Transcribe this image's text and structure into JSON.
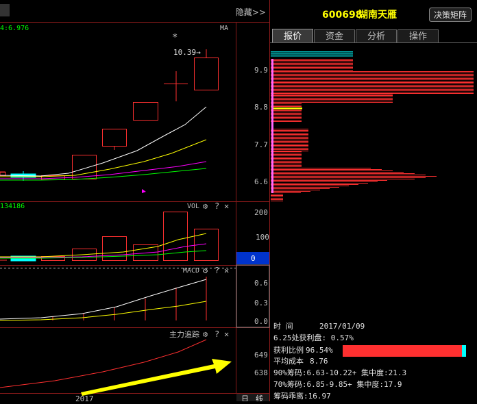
{
  "colors": {
    "bg": "#000000",
    "up": "#ff3030",
    "down": "#00ffff",
    "ma_white": "#ffffff",
    "ma_yellow": "#ffff00",
    "ma_magenta": "#ff00ff",
    "ma_green": "#00ff00",
    "label": "#c0c0c0",
    "stock": "#ffff00",
    "selected_value_bg": "#0033cc",
    "profit_bar": "#ff3030",
    "profit_bar_tail": "#00ffff"
  },
  "header": {
    "hide_label": "隐藏>>",
    "stock_code": "600698",
    "stock_name": "湖南天雁",
    "matrix_button": "决策矩阵"
  },
  "tabs": [
    {
      "label": "报价",
      "active": true
    },
    {
      "label": "资金",
      "active": false
    },
    {
      "label": "分析",
      "active": false
    },
    {
      "label": "操作",
      "active": false
    }
  ],
  "main_chart": {
    "ma_readout": "4:6.976",
    "ma_label": "MA",
    "star_marker": "*",
    "high_label": "10.39→",
    "price_ticks": [
      "9.9",
      "8.8",
      "7.7",
      "6.6"
    ]
  },
  "vol_panel": {
    "readout": "134186",
    "title": "VOL",
    "ticks": [
      "200",
      "100"
    ],
    "selected_value": "0"
  },
  "macd_panel": {
    "title": "MACD",
    "ticks": [
      "0.6",
      "0.3",
      "0.0"
    ]
  },
  "main_force_panel": {
    "title": "主力追踪",
    "ticks": [
      "649",
      "638"
    ]
  },
  "bottom_bar": {
    "year": "2017",
    "period_day": "日",
    "period_line": "线"
  },
  "panel_controls": {
    "gear": "⚙",
    "help": "?",
    "close": "✕"
  },
  "chip_info": {
    "time_label": "时        间",
    "time_value": "2017/01/09",
    "profit_line": "6.25处获利盘: 0.57%",
    "profit_ratio_label": "获利比例",
    "profit_ratio_value": "96.54%",
    "profit_ratio_fraction": 0.9654,
    "avg_cost_label": "平均成本",
    "avg_cost_value": "8.76",
    "chip90": "90%筹码:6.63-10.22+ 集中度:21.3",
    "chip70": "70%筹码:6.85-9.85+ 集中度:17.9",
    "deviation": "筹码乖离:16.97"
  }
}
